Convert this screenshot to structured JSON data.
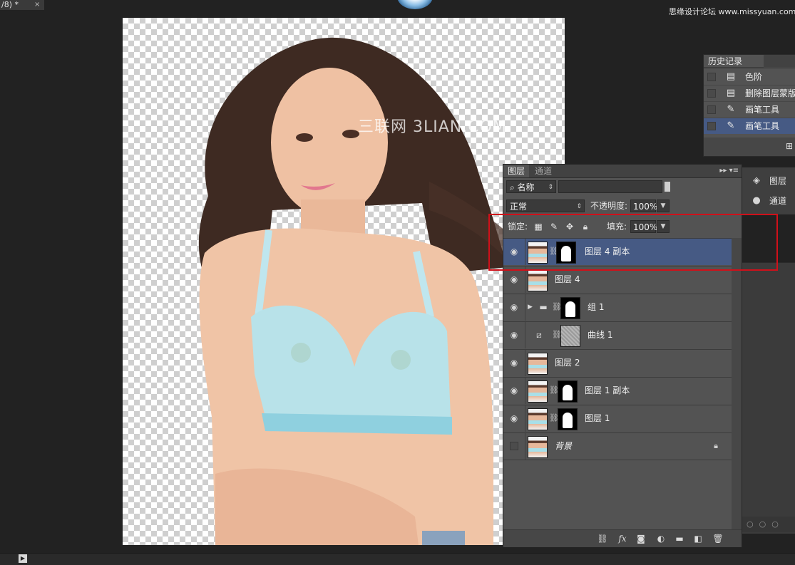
{
  "document": {
    "tab_title": "/8) *",
    "close_glyph": "×"
  },
  "watermarks": {
    "site": "思缘设计论坛 www.missyuan.com",
    "canvas": "三联网 3LIAN.COM"
  },
  "history": {
    "title": "历史记录",
    "items": [
      {
        "label": "色阶",
        "icon": "document-icon",
        "selected": false
      },
      {
        "label": "删除图层蒙版",
        "icon": "document-icon",
        "selected": false
      },
      {
        "label": "画笔工具",
        "icon": "brush-icon",
        "selected": false
      },
      {
        "label": "画笔工具",
        "icon": "brush-icon",
        "selected": true
      }
    ]
  },
  "side_dock": {
    "items": [
      {
        "label": "图层",
        "icon": "layers-icon"
      },
      {
        "label": "通道",
        "icon": "channels-icon"
      }
    ]
  },
  "layers_panel": {
    "tabs": [
      "图层",
      "通道"
    ],
    "filter": {
      "kind": "名称",
      "value": ""
    },
    "blend_mode": "正常",
    "opacity_label": "不透明度:",
    "opacity_value": "100%",
    "lock_label": "锁定:",
    "fill_label": "填充:",
    "fill_value": "100%",
    "layers": [
      {
        "name": "图层 4 副本",
        "visible": true,
        "selected": true,
        "has_mask": true,
        "type": "pixel"
      },
      {
        "name": "图层 4",
        "visible": true,
        "selected": false,
        "has_mask": false,
        "type": "pixel"
      },
      {
        "name": "组 1",
        "visible": true,
        "selected": false,
        "has_mask": true,
        "type": "group"
      },
      {
        "name": "曲线 1",
        "visible": true,
        "selected": false,
        "has_mask": true,
        "type": "adjustment"
      },
      {
        "name": "图层 2",
        "visible": true,
        "selected": false,
        "has_mask": false,
        "type": "pixel"
      },
      {
        "name": "图层 1 副本",
        "visible": true,
        "selected": false,
        "has_mask": true,
        "type": "pixel"
      },
      {
        "name": "图层 1",
        "visible": true,
        "selected": false,
        "has_mask": true,
        "type": "pixel"
      },
      {
        "name": "背景",
        "visible": false,
        "selected": false,
        "has_mask": false,
        "type": "background",
        "locked": true
      }
    ],
    "footer_icons": [
      "link-layers-icon",
      "fx-icon",
      "add-mask-icon",
      "adjustment-layer-icon",
      "new-group-icon",
      "new-layer-icon",
      "delete-layer-icon"
    ],
    "fx_label": "fx"
  },
  "colors": {
    "highlight": "#d0101a",
    "selection": "#465a84",
    "panel": "#535353"
  }
}
